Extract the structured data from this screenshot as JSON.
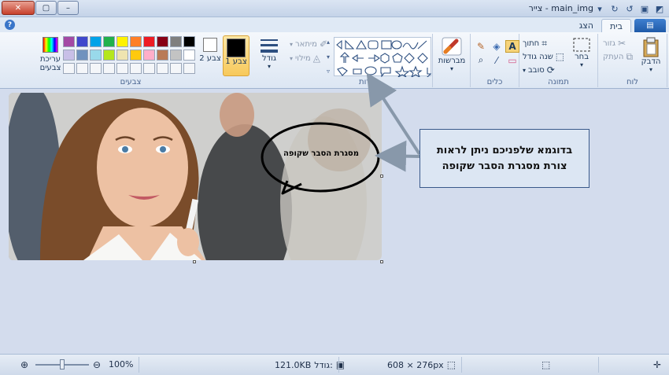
{
  "window": {
    "title": "צייר - main_img",
    "close_label": "✕",
    "max_label": "▢",
    "min_label": "–"
  },
  "tabs": {
    "file": "▤",
    "home": "בית",
    "view": "הצג"
  },
  "ribbon": {
    "clipboard": {
      "label": "לוח",
      "paste": "הדבק",
      "cut": "גזור",
      "copy": "העתק"
    },
    "image": {
      "label": "תמונה",
      "select": "בחר",
      "crop": "חתוך",
      "resize": "שנה גודל",
      "rotate": "סובב"
    },
    "tools": {
      "label": "כלים"
    },
    "brushes": {
      "label": "מברשות"
    },
    "shapes": {
      "label": "צורות",
      "outline": "מיתאר",
      "fill": "מילוי"
    },
    "size": {
      "label": "גודל"
    },
    "color1": {
      "label": "צבע 1"
    },
    "color2": {
      "label": "צבע 2"
    },
    "colors": {
      "label": "צבעים",
      "edit": "עריכת צבעים"
    }
  },
  "palette": [
    "#000000",
    "#7f7f7f",
    "#880015",
    "#ed1c24",
    "#ff7f27",
    "#fff200",
    "#22b14c",
    "#00a2e8",
    "#3f48cc",
    "#a349a4",
    "#ffffff",
    "#c3c3c3",
    "#b97a57",
    "#ffaec9",
    "#ffc90e",
    "#efe4b0",
    "#b5e61d",
    "#99d9ea",
    "#7092be",
    "#c8bfe7",
    "#f4f6f9",
    "#f4f6f9",
    "#f4f6f9",
    "#f4f6f9",
    "#f4f6f9",
    "#f4f6f9",
    "#f4f6f9",
    "#f4f6f9",
    "#f4f6f9",
    "#f4f6f9"
  ],
  "canvas": {
    "bubble_text": "מסגרת הסבר שקופה",
    "callout_line1": "בדוגמא שלפניכם ניתן לראות",
    "callout_line2": "צורת מסגרת הסבר שקופה"
  },
  "status": {
    "zoom": "100%",
    "size_label": "גודל:",
    "size_value": "121.0KB",
    "dimensions": "608 × 276px"
  }
}
